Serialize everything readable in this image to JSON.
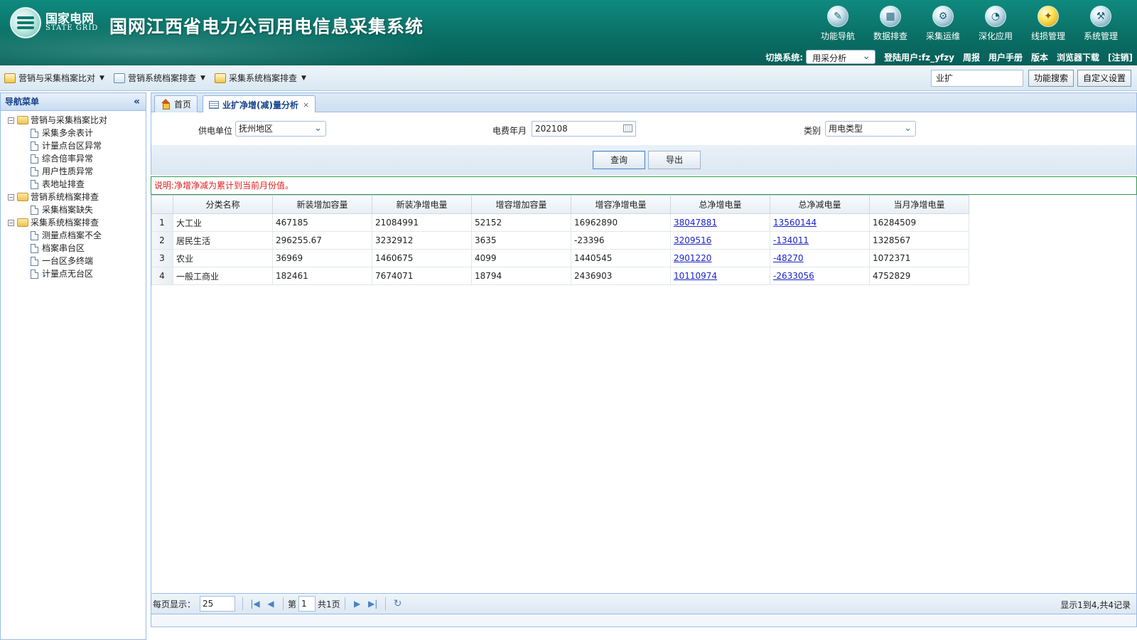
{
  "header": {
    "brand_cn": "国家电网",
    "brand_en": "STATE GRID",
    "title": "国网江西省电力公司用电信息采集系统",
    "nav": [
      {
        "label": "功能导航",
        "icon": "function-nav-icon",
        "glyph": "✎"
      },
      {
        "label": "数据排查",
        "icon": "data-check-icon",
        "glyph": "▦"
      },
      {
        "label": "采集运维",
        "icon": "collect-maintain-icon",
        "glyph": "⚙"
      },
      {
        "label": "深化应用",
        "icon": "deep-apply-icon",
        "glyph": "◔"
      },
      {
        "label": "线损管理",
        "icon": "line-loss-icon",
        "glyph": "✦"
      },
      {
        "label": "系统管理",
        "icon": "system-manage-icon",
        "glyph": "⚒"
      }
    ],
    "switch_label": "切换系统:",
    "switch_value": "用采分析",
    "login_user": "登陆用户:fz_yfzy",
    "links": [
      "周报",
      "用户手册",
      "版本",
      "浏览器下载",
      "[注销]"
    ]
  },
  "toolbar": {
    "menus": [
      "营销与采集档案比对",
      "营销系统档案排查",
      "采集系统档案排查"
    ],
    "search_value": "业扩",
    "search_button": "功能搜索",
    "custom_button": "自定义设置"
  },
  "sidebar": {
    "title": "导航菜单",
    "groups": [
      {
        "label": "营销与采集档案比对",
        "items": [
          "采集多余表计",
          "计量点台区异常",
          "综合倍率异常",
          "用户性质异常",
          "表地址排查"
        ]
      },
      {
        "label": "营销系统档案排查",
        "items": [
          "采集档案缺失"
        ]
      },
      {
        "label": "采集系统档案排查",
        "items": [
          "测量点档案不全",
          "档案串台区",
          "一台区多终端",
          "计量点无台区"
        ]
      }
    ]
  },
  "tabs": {
    "home": "首页",
    "active": "业扩净增(减)量分析"
  },
  "filter": {
    "unit_label": "供电单位",
    "unit_value": "抚州地区",
    "month_label": "电费年月",
    "month_value": "202108",
    "type_label": "类别",
    "type_value": "用电类型"
  },
  "actions": {
    "query": "查询",
    "export": "导出"
  },
  "notice": "说明:净增净减为累计到当前月份值。",
  "table": {
    "columns": [
      "分类名称",
      "新装增加容量",
      "新装净增电量",
      "增容增加容量",
      "增容净增电量",
      "总净增电量",
      "总净减电量",
      "当月净增电量"
    ],
    "rows": [
      [
        "大工业",
        "467185",
        "21084991",
        "52152",
        "16962890",
        "38047881",
        "13560144",
        "16284509"
      ],
      [
        "居民生活",
        "296255.67",
        "3232912",
        "3635",
        "-23396",
        "3209516",
        "-134011",
        "1328567"
      ],
      [
        "农业",
        "36969",
        "1460675",
        "4099",
        "1440545",
        "2901220",
        "-48270",
        "1072371"
      ],
      [
        "一般工商业",
        "182461",
        "7674071",
        "18794",
        "2436903",
        "10110974",
        "-2633056",
        "4752829"
      ]
    ]
  },
  "pager": {
    "page_size_label": "每页显示：",
    "page_size": "25",
    "page_prefix": "第",
    "page_value": "1",
    "page_total": "共1页",
    "info": "显示1到4,共4记录"
  }
}
